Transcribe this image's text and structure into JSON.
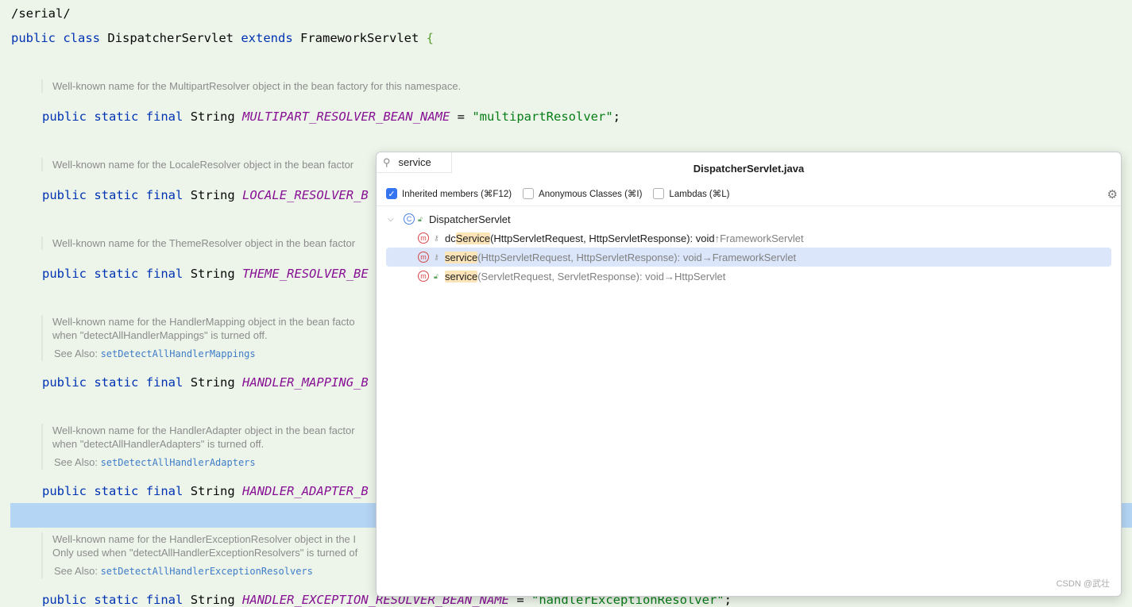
{
  "editor": {
    "line0": "/serial/",
    "class_line": {
      "kw1": "public",
      "kw2": "class",
      "name": "DispatcherServlet",
      "kw3": "extends",
      "parent": "FrameworkServlet",
      "brace": "{"
    },
    "blocks": [
      {
        "doc": [
          "Well-known name for the MultipartResolver object in the bean factory for this namespace."
        ],
        "see": "",
        "const": "MULTIPART_RESOLVER_BEAN_NAME",
        "tail": " = ",
        "value": "\"multipartResolver\"",
        "end": ";"
      },
      {
        "doc": [
          "Well-known name for the LocaleResolver object in the bean factor"
        ],
        "see": "",
        "const": "LOCALE_RESOLVER_B"
      },
      {
        "doc": [
          "Well-known name for the ThemeResolver object in the bean factor"
        ],
        "see": "",
        "const": "THEME_RESOLVER_BE"
      },
      {
        "doc": [
          "Well-known name for the HandlerMapping object in the bean facto",
          "when \"detectAllHandlerMappings\" is turned off."
        ],
        "see": "setDetectAllHandlerMappings",
        "const": "HANDLER_MAPPING_B"
      },
      {
        "doc": [
          "Well-known name for the HandlerAdapter object in the bean factor",
          "when \"detectAllHandlerAdapters\" is turned off."
        ],
        "see": "setDetectAllHandlerAdapters",
        "const": "HANDLER_ADAPTER_B"
      },
      {
        "doc": [
          "Well-known name for the HandlerExceptionResolver object in the I",
          "Only used when \"detectAllHandlerExceptionResolvers\" is turned of"
        ],
        "see": "setDetectAllHandlerExceptionResolvers",
        "const": "HANDLER_EXCEPTION_RESOLVER_BEAN_NAME",
        "tail": " = ",
        "value": "\"handlerExceptionResolver\"",
        "end": ";"
      }
    ],
    "decl_prefix": {
      "kw1": "public",
      "kw2": "static",
      "kw3": "final",
      "type": "String"
    },
    "see_label": "See Also:"
  },
  "popup": {
    "search_value": "service",
    "title": "DispatcherServlet.java",
    "options": [
      {
        "label": "Inherited members (⌘F12)",
        "checked": true
      },
      {
        "label": "Anonymous Classes (⌘I)",
        "checked": false
      },
      {
        "label": "Lambdas (⌘L)",
        "checked": false
      }
    ],
    "root": "DispatcherServlet",
    "items": [
      {
        "pre": "dc",
        "match": "Service",
        "sig": "(HttpServletRequest, HttpServletResponse): void ",
        "origin": "↑FrameworkServlet",
        "access": "protected",
        "selected": false
      },
      {
        "pre": "",
        "match": "service",
        "sig": "(HttpServletRequest, HttpServletResponse): void ",
        "origin": "→FrameworkServlet",
        "access": "protected",
        "selected": true
      },
      {
        "pre": "",
        "match": "service",
        "sig": "(ServletRequest, ServletResponse): void ",
        "origin": "→HttpServlet",
        "access": "public",
        "selected": false
      }
    ]
  },
  "watermark": "CSDN @武壮"
}
